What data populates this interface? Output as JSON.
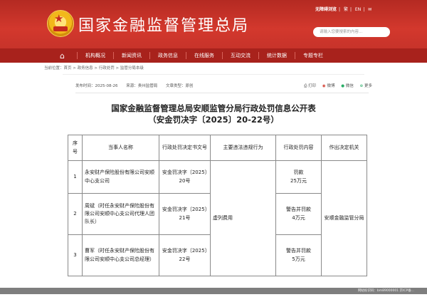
{
  "header": {
    "site_title": "国家金融监督管理总局",
    "toplinks": [
      "无障碍浏览",
      "繁",
      "EN",
      "✉"
    ],
    "search_placeholder": "请输入您要搜索的内容...",
    "search_icon": "search-icon"
  },
  "nav": {
    "home_icon": "home-icon",
    "items": [
      "机构概况",
      "新闻资讯",
      "政务信息",
      "在线服务",
      "互动交流",
      "统计数据",
      "专题专栏"
    ]
  },
  "breadcrumb": "当前位置：首页 > 政务信息 > 行政处罚 > 监管分局本级",
  "meta": {
    "publish_time": "发布时间：2025-08-26",
    "source": "来源：贵州监管局",
    "doc_type": "文章类型：原创"
  },
  "share": {
    "print": "打印",
    "weibo": "微博",
    "wechat": "微信",
    "more": "更多"
  },
  "title_line1": "国家金融监督管理总局安顺监管分局行政处罚信息公开表",
  "title_line2": "（安金罚决字〔2025〕20-22号）",
  "table": {
    "headers": [
      "序号",
      "当事人名称",
      "行政处罚决定书文号",
      "主要违法违规行为",
      "行政处罚内容",
      "作出决定机关"
    ],
    "rows": [
      {
        "no": "1",
        "party": "永安财产保险股份有限公司安顺中心支公司",
        "doc": "安金罚决字〔2025〕20号",
        "penalty": "罚款\n25万元"
      },
      {
        "no": "2",
        "party": "周斌（时任永安财产保险股份有限公司安顺中心支公司代理人团队长）",
        "doc": "安金罚决字〔2025〕21号",
        "penalty": "警告并罚款\n4万元"
      },
      {
        "no": "3",
        "party": "曹军（时任永安财产保险股份有限公司安顺中心支公司总经理）",
        "doc": "安金罚决字〔2025〕22号",
        "penalty": "警告并罚款\n5万元"
      }
    ],
    "violation": "虚列费用",
    "authority": "安顺金融监管分局"
  },
  "footer_text": "网站标识码：bm89000001  京ICP备..."
}
